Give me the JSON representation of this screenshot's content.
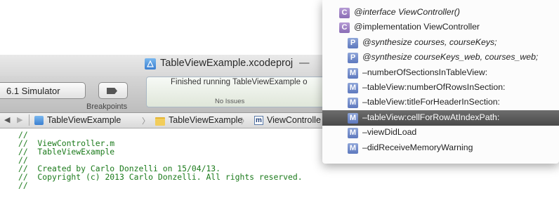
{
  "window": {
    "title": "TableViewExample.xcodeproj",
    "title_dash": "—"
  },
  "toolbar": {
    "scheme": "6.1 Simulator",
    "breakpoints_label": "Breakpoints",
    "activity_status": "Finished running TableViewExample o",
    "activity_issues": "No Issues"
  },
  "jumpbar": {
    "back": "◀",
    "forward": "▶",
    "items": [
      "TableViewExample",
      "TableViewExample",
      "ViewControlle"
    ],
    "chevron": "〉"
  },
  "editor": {
    "lines": [
      "//",
      "//  ViewController.m",
      "//  TableViewExample",
      "//",
      "//  Created by Carlo Donzelli on 15/04/13.",
      "//  Copyright (c) 2013 Carlo Donzelli. All rights reserved.",
      "//"
    ]
  },
  "popup": {
    "items": [
      {
        "badge": "C",
        "kind": "c",
        "label": "@interface ViewController()",
        "italic": true,
        "indent": 0,
        "selected": false
      },
      {
        "badge": "C",
        "kind": "c",
        "label": "@implementation ViewController",
        "italic": false,
        "indent": 0,
        "selected": false
      },
      {
        "badge": "P",
        "kind": "p",
        "label": "@synthesize courses, courseKeys;",
        "italic": true,
        "indent": 1,
        "selected": false
      },
      {
        "badge": "P",
        "kind": "p",
        "label": "@synthesize courseKeys_web, courses_web;",
        "italic": true,
        "indent": 1,
        "selected": false
      },
      {
        "badge": "M",
        "kind": "m",
        "label": "–numberOfSectionsInTableView:",
        "italic": false,
        "indent": 1,
        "selected": false
      },
      {
        "badge": "M",
        "kind": "m",
        "label": "–tableView:numberOfRowsInSection:",
        "italic": false,
        "indent": 1,
        "selected": false
      },
      {
        "badge": "M",
        "kind": "m",
        "label": "–tableView:titleForHeaderInSection:",
        "italic": false,
        "indent": 1,
        "selected": false
      },
      {
        "badge": "M",
        "kind": "m",
        "label": "–tableView:cellForRowAtIndexPath:",
        "italic": false,
        "indent": 1,
        "selected": true
      },
      {
        "badge": "M",
        "kind": "m",
        "label": "–viewDidLoad",
        "italic": false,
        "indent": 1,
        "selected": false
      },
      {
        "badge": "M",
        "kind": "m",
        "label": "–didReceiveMemoryWarning",
        "italic": false,
        "indent": 1,
        "selected": false
      }
    ]
  }
}
